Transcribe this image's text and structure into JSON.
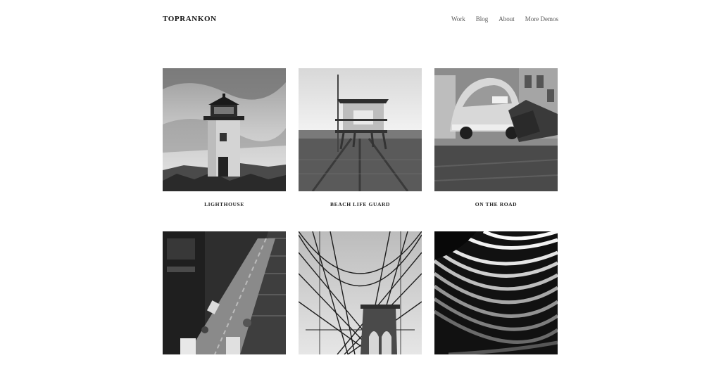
{
  "header": {
    "brand": "TOPRANKON",
    "nav": [
      {
        "label": "Work"
      },
      {
        "label": "Blog"
      },
      {
        "label": "About"
      },
      {
        "label": "More Demos"
      }
    ]
  },
  "portfolio": {
    "items": [
      {
        "title": "LIGHTHOUSE"
      },
      {
        "title": "BEACH LIFE GUARD"
      },
      {
        "title": "ON THE ROAD"
      },
      {
        "title": ""
      },
      {
        "title": ""
      },
      {
        "title": ""
      }
    ]
  }
}
